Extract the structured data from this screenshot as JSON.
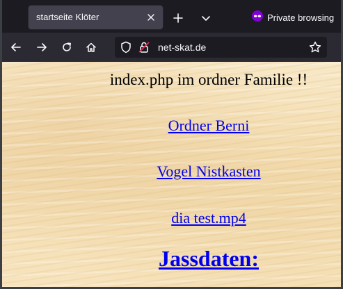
{
  "browser": {
    "tab": {
      "title": "startseite Klöter"
    },
    "private_label": "Private browsing",
    "url": "net-skat.de"
  },
  "page": {
    "heading": "index.php im ordner Familie !!",
    "links": [
      {
        "label": "Ordner Berni"
      },
      {
        "label": "Vogel Nistkasten"
      },
      {
        "label": "dia test.mp4"
      },
      {
        "label": "Jassdaten:"
      }
    ]
  },
  "colors": {
    "tab_bg": "#42414d",
    "toolbar_bg": "#2b2a33",
    "frame_bg": "#1c1b22",
    "private_icon": "#8000d7",
    "link": "#0000ee",
    "page_bg": "#f6e2bc"
  },
  "icons": {
    "tab_close": "close-icon",
    "new_tab": "plus-icon",
    "tab_list": "chevron-down-icon",
    "private": "private-mask-icon",
    "back": "arrow-left-icon",
    "forward": "arrow-right-icon",
    "reload": "reload-icon",
    "home": "home-icon",
    "tracking": "shield-icon",
    "insecure": "lock-insecure-icon",
    "bookmark": "star-icon"
  }
}
